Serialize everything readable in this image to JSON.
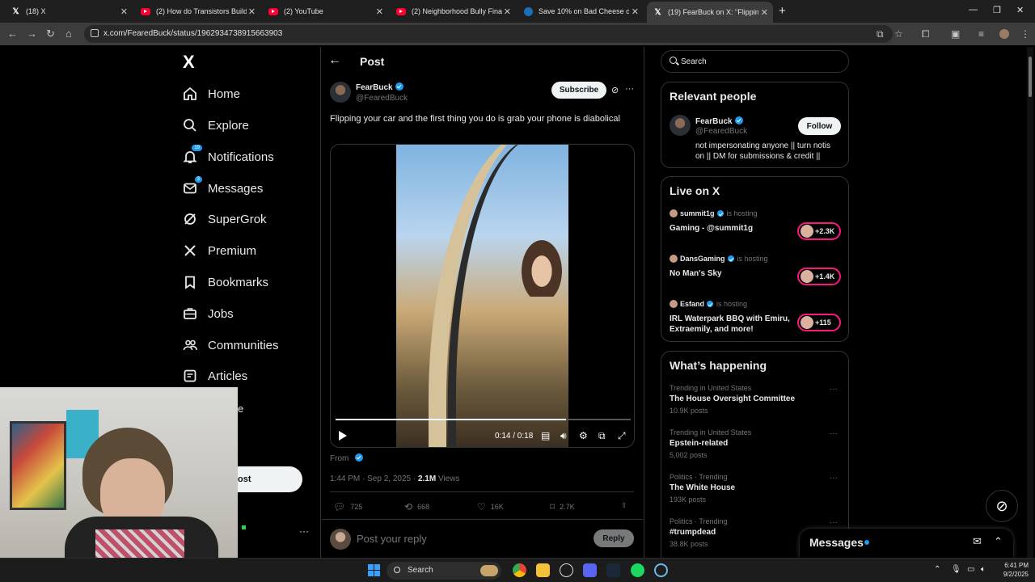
{
  "browser": {
    "tabs": [
      {
        "label": "(18) X",
        "icon": "x-icon"
      },
      {
        "label": "(2) How do Transistors Build into",
        "icon": "youtube-icon"
      },
      {
        "label": "(2) YouTube",
        "icon": "youtube-icon"
      },
      {
        "label": "(2) Neighborhood Bully Finally",
        "icon": "youtube-icon"
      },
      {
        "label": "Save 10% on Bad Cheese on St",
        "icon": "steam-icon"
      },
      {
        "label": "(19) FearBuck on X: \"Flipping yo",
        "icon": "x-icon"
      }
    ],
    "url": "x.com/FearedBuck/status/1962934738915663903"
  },
  "nav": {
    "logo": "X",
    "items": [
      {
        "label": "Home",
        "icon": "home-icon"
      },
      {
        "label": "Explore",
        "icon": "search-icon"
      },
      {
        "label": "Notifications",
        "icon": "bell-icon",
        "badge": "19"
      },
      {
        "label": "Messages",
        "icon": "mail-icon",
        "badge": "3"
      },
      {
        "label": "SuperGrok",
        "icon": "grok-icon"
      },
      {
        "label": "Premium",
        "icon": "x-icon"
      },
      {
        "label": "Bookmarks",
        "icon": "bookmark-icon"
      },
      {
        "label": "Jobs",
        "icon": "briefcase-icon"
      },
      {
        "label": "Communities",
        "icon": "people-icon"
      },
      {
        "label": "Articles",
        "icon": "article-icon"
      }
    ],
    "partial_label": "e",
    "post_fragment": "ost",
    "more_dots": "···"
  },
  "post": {
    "header_title": "Post",
    "author_name": "FearBuck",
    "author_handle": "@FearedBuck",
    "subscribe_label": "Subscribe",
    "text": "Flipping your car and the first thing you do is grab your phone is diabolical",
    "video": {
      "time": "0:14 / 0:18",
      "progress": 0.78
    },
    "from_label": "From",
    "timestamp": "1:44 PM · Sep 2, 2025 · ",
    "views_count": "2.1M",
    "views_label": " Views",
    "actions": {
      "replies": "725",
      "reposts": "668",
      "likes": "16K",
      "bookmarks": "2.7K"
    },
    "reply_placeholder": "Post your reply",
    "reply_button": "Reply"
  },
  "right": {
    "search_placeholder": "Search",
    "relevant": {
      "title": "Relevant people",
      "name": "FearBuck",
      "handle": "@FearedBuck",
      "follow_label": "Follow",
      "bio": "not impersonating anyone || turn notis on || DM for submissions & credit ||"
    },
    "live": {
      "title": "Live on X",
      "items": [
        {
          "host": "summit1g",
          "hosting": "is hosting",
          "title": "Gaming - @summit1g",
          "count": "+2.3K"
        },
        {
          "host": "DansGaming",
          "hosting": "is hosting",
          "title": "No Man's Sky",
          "count": "+1.4K"
        },
        {
          "host": "Esfand",
          "hosting": "is hosting",
          "title": "IRL Waterpark BBQ with Emiru, Extraemily, and more!",
          "count": "+115"
        }
      ]
    },
    "happening": {
      "title": "What’s happening",
      "items": [
        {
          "context": "Trending in United States",
          "name": "The House Oversight Committee",
          "posts": "10.9K posts"
        },
        {
          "context": "Trending in United States",
          "name": "Epstein-related",
          "posts": "5,002 posts"
        },
        {
          "context": "Politics · Trending",
          "name": "The White House",
          "posts": "193K posts"
        },
        {
          "context": "Politics · Trending",
          "name": "#trumpdead",
          "posts": "38.8K posts"
        }
      ]
    },
    "messages_drawer": "Messages"
  },
  "taskbar": {
    "search_label": "Search",
    "time": "6:41 PM",
    "date": "9/2/2025"
  }
}
